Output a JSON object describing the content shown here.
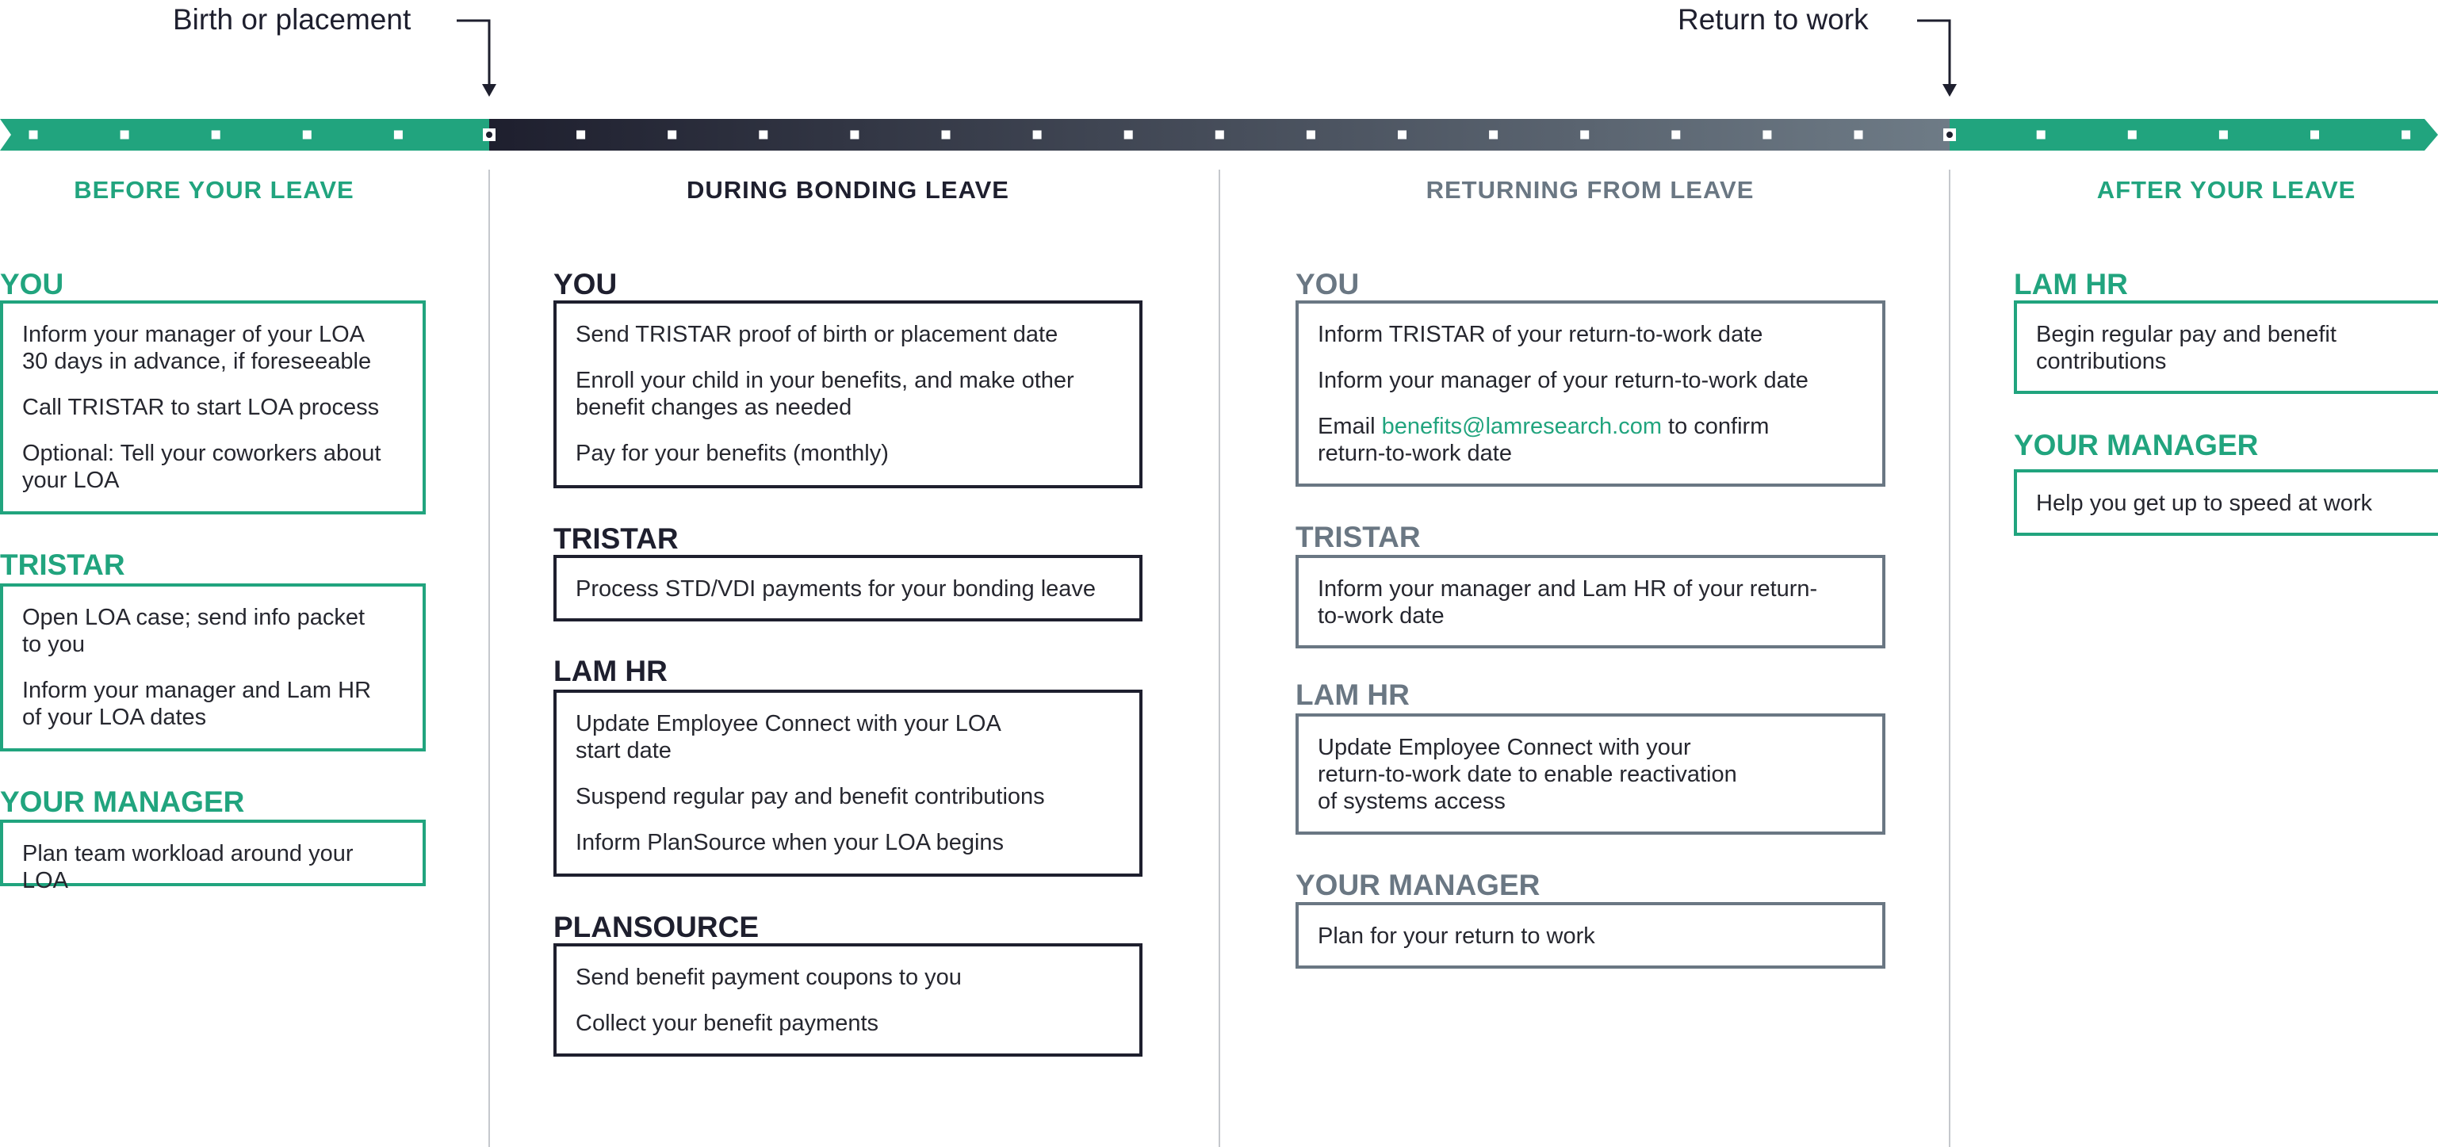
{
  "pointers": {
    "start": "Birth or placement",
    "end": "Return to work"
  },
  "colors": {
    "green": "#21a47e",
    "navy": "#1e1f2e",
    "slate": "#6a7783"
  },
  "phases": {
    "before": {
      "title": "BEFORE YOUR LEAVE",
      "you": {
        "heading": "YOU",
        "items": [
          "Inform your manager of your LOA\n30 days in advance, if foreseeable",
          "Call TRISTAR to start LOA process",
          "Optional: Tell your coworkers about\nyour LOA"
        ]
      },
      "tristar": {
        "heading": "TRISTAR",
        "items": [
          "Open LOA case; send info packet\nto you",
          "Inform your manager and Lam HR\nof your LOA dates"
        ]
      },
      "manager": {
        "heading": "YOUR MANAGER",
        "items": [
          "Plan team workload around your LOA"
        ]
      }
    },
    "during": {
      "title": "DURING BONDING LEAVE",
      "you": {
        "heading": "YOU",
        "items": [
          "Send TRISTAR proof of birth or placement date",
          "Enroll your child in your benefits, and make other\nbenefit changes as needed",
          "Pay for your benefits (monthly)"
        ]
      },
      "tristar": {
        "heading": "TRISTAR",
        "items": [
          "Process STD/VDI payments for your bonding leave"
        ]
      },
      "lamhr": {
        "heading": "LAM HR",
        "items": [
          "Update Employee Connect with your LOA\nstart date",
          "Suspend regular pay and benefit contributions",
          "Inform PlanSource when your LOA begins"
        ]
      },
      "plansource": {
        "heading": "PLANSOURCE",
        "items": [
          "Send benefit payment coupons to you",
          "Collect your benefit payments"
        ]
      }
    },
    "returning": {
      "title": "RETURNING FROM LEAVE",
      "you": {
        "heading": "YOU",
        "items": [
          "Inform TRISTAR of your return-to-work date",
          "Inform your manager of your return-to-work date"
        ],
        "email_prefix": "Email ",
        "email_link": "benefits@lamresearch.com",
        "email_suffix": " to confirm\nreturn-to-work date"
      },
      "tristar": {
        "heading": "TRISTAR",
        "items": [
          "Inform your manager and Lam HR of your return-\nto-work date"
        ]
      },
      "lamhr": {
        "heading": "LAM HR",
        "items": [
          "Update Employee Connect with your\nreturn-to-work date to enable reactivation\nof systems access"
        ]
      },
      "manager": {
        "heading": "YOUR MANAGER",
        "items": [
          "Plan for your return to work"
        ]
      }
    },
    "after": {
      "title": "AFTER YOUR LEAVE",
      "lamhr": {
        "heading": "LAM HR",
        "items": [
          "Begin regular pay and benefit\ncontributions"
        ]
      },
      "manager": {
        "heading": "YOUR MANAGER",
        "items": [
          "Help you get up to speed at work"
        ]
      }
    }
  }
}
